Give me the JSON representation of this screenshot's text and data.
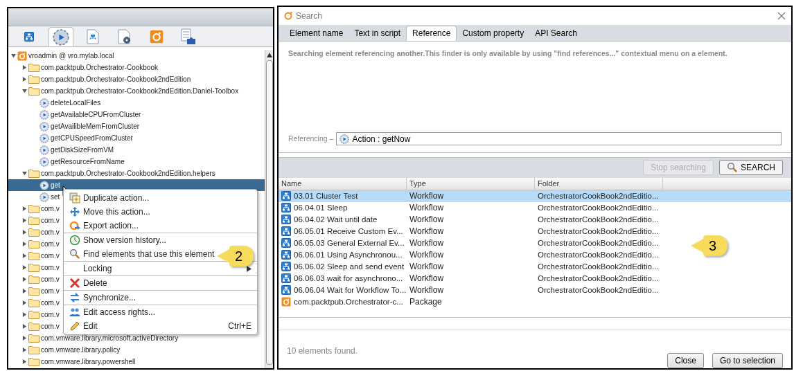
{
  "left_panel": {
    "toolbar_tabs": [
      {
        "kind": "workflows",
        "selected": false
      },
      {
        "kind": "actions",
        "selected": true
      },
      {
        "kind": "policies",
        "selected": false
      },
      {
        "kind": "configurations",
        "selected": false
      },
      {
        "kind": "packages",
        "selected": false
      },
      {
        "kind": "resources",
        "selected": false
      }
    ],
    "tree": [
      {
        "label": "vroadmin @ vro.mylab.local",
        "kind": "server",
        "expanded": true,
        "children": [
          {
            "label": "com.packtpub.Orchestrator-Cookbook",
            "kind": "folder",
            "expanded": false
          },
          {
            "label": "com.packtpub.Orchestrator-Cookbook2ndEdition",
            "kind": "folder",
            "expanded": false
          },
          {
            "label": "com.packtpub.Orchestrator-Cookbook2ndEdition.Daniel-Toolbox",
            "kind": "folder",
            "expanded": true,
            "children": [
              {
                "label": "deleteLocalFiles",
                "kind": "action",
                "selected": false
              },
              {
                "label": "getAvailableCPUFromCluster",
                "kind": "action",
                "selected": false
              },
              {
                "label": "getAvailibleMemFromCluster",
                "kind": "action",
                "selected": false
              },
              {
                "label": "getCPUSpeedFromCluster",
                "kind": "action",
                "selected": false
              },
              {
                "label": "getDiskSizeFromVM",
                "kind": "action",
                "selected": false
              },
              {
                "label": "getResourceFromName",
                "kind": "action",
                "selected": false
              }
            ]
          },
          {
            "label": "com.packtpub.Orchestrator-Cookbook2ndEdition.helpers",
            "kind": "folder",
            "expanded": true,
            "children": [
              {
                "label": "get",
                "kind": "action",
                "selected": true
              },
              {
                "label": "set",
                "kind": "action",
                "selected": false
              }
            ]
          },
          {
            "label": "com.v",
            "kind": "folder",
            "expanded": false
          },
          {
            "label": "com.v",
            "kind": "folder",
            "expanded": false
          },
          {
            "label": "com.v",
            "kind": "folder",
            "expanded": false
          },
          {
            "label": "com.v",
            "kind": "folder",
            "expanded": false
          },
          {
            "label": "com.v",
            "kind": "folder",
            "expanded": false
          },
          {
            "label": "com.v",
            "kind": "folder",
            "expanded": false
          },
          {
            "label": "com.v",
            "kind": "folder",
            "expanded": false
          },
          {
            "label": "com.v",
            "kind": "folder",
            "expanded": false
          },
          {
            "label": "com.v",
            "kind": "folder",
            "expanded": false
          },
          {
            "label": "com.v",
            "kind": "folder",
            "expanded": false
          },
          {
            "label": "com.v",
            "kind": "folder",
            "expanded": false
          },
          {
            "label": "com.vmware.library.microsoft.activeDirectory",
            "kind": "folder",
            "expanded": false
          },
          {
            "label": "com.vmware.library.policy",
            "kind": "folder",
            "expanded": false
          },
          {
            "label": "com.vmware.library.powershell",
            "kind": "folder",
            "expanded": false
          }
        ]
      }
    ],
    "context_menu": {
      "groups": [
        [
          {
            "label": "Duplicate action...",
            "kind": "duplicate"
          },
          {
            "label": "Move this action...",
            "kind": "move"
          },
          {
            "label": "Export action...",
            "kind": "export"
          }
        ],
        [
          {
            "label": "Show version history...",
            "kind": "history"
          },
          {
            "label": "Find elements that use this element",
            "kind": "search"
          }
        ],
        [
          {
            "label": "Locking",
            "kind": "submenu",
            "has_submenu": true
          }
        ],
        [
          {
            "label": "Delete",
            "kind": "delete"
          }
        ],
        [
          {
            "label": "Synchronize...",
            "kind": "sync"
          }
        ],
        [
          {
            "label": "Edit access rights...",
            "kind": "users"
          },
          {
            "label": "Edit",
            "kind": "edit",
            "shortcut": "Ctrl+E"
          }
        ]
      ]
    },
    "callout": "2"
  },
  "search_dialog": {
    "title": "Search",
    "tabs": [
      {
        "label": "Element name",
        "selected": false
      },
      {
        "label": "Text in script",
        "selected": false
      },
      {
        "label": "Reference",
        "selected": true
      },
      {
        "label": "Custom property",
        "selected": false
      },
      {
        "label": "API Search",
        "selected": false
      }
    ],
    "description": "Searching element referencing another.This finder is only available by using \"find references...\" contextual menu on a element.",
    "referencing": {
      "label": "Referencing –",
      "value": "Action : getNow"
    },
    "buttons_top": [
      {
        "label": "Stop searching",
        "disabled": true
      },
      {
        "label": "SEARCH",
        "disabled": false
      }
    ],
    "table": {
      "columns": [
        "Name",
        "Type",
        "Folder"
      ],
      "rows": [
        {
          "name": "03.01 Cluster Test",
          "type": "Workflow",
          "folder": "OrchestratorCookBook2ndEditio...",
          "kind": "workflow",
          "selected": true
        },
        {
          "name": "06.04.01 Sleep",
          "type": "Workflow",
          "folder": "OrchestratorCookBook2ndEditio...",
          "kind": "workflow",
          "selected": false
        },
        {
          "name": "06.04.02 Wait until date",
          "type": "Workflow",
          "folder": "OrchestratorCookBook2ndEditio...",
          "kind": "workflow",
          "selected": false
        },
        {
          "name": "06.05.01 Receive Custom Ev...",
          "type": "Workflow",
          "folder": "OrchestratorCookBook2ndEditio...",
          "kind": "workflow",
          "selected": false
        },
        {
          "name": "06.05.03 General External Ev...",
          "type": "Workflow",
          "folder": "OrchestratorCookBook2ndEditio...",
          "kind": "workflow",
          "selected": false
        },
        {
          "name": "06.06.01 Using Asynchronou...",
          "type": "Workflow",
          "folder": "OrchestratorCookBook2ndEditio...",
          "kind": "workflow",
          "selected": false
        },
        {
          "name": "06.06.02 Sleep and send event",
          "type": "Workflow",
          "folder": "OrchestratorCookBook2ndEditio...",
          "kind": "workflow",
          "selected": false
        },
        {
          "name": "06.06.03 wait for asynchrono...",
          "type": "Workflow",
          "folder": "OrchestratorCookBook2ndEditio...",
          "kind": "workflow",
          "selected": false
        },
        {
          "name": "06.06.04 Wait for Workflow To...",
          "type": "Workflow",
          "folder": "OrchestratorCookBook2ndEditio...",
          "kind": "workflow",
          "selected": false
        },
        {
          "name": "com.packtpub.Orchestrator-c...",
          "type": "Package",
          "kind": "package",
          "selected": false
        }
      ]
    },
    "status": "10 elements found.",
    "buttons_bottom": [
      "Close",
      "Go to selection"
    ],
    "callout": "3"
  }
}
